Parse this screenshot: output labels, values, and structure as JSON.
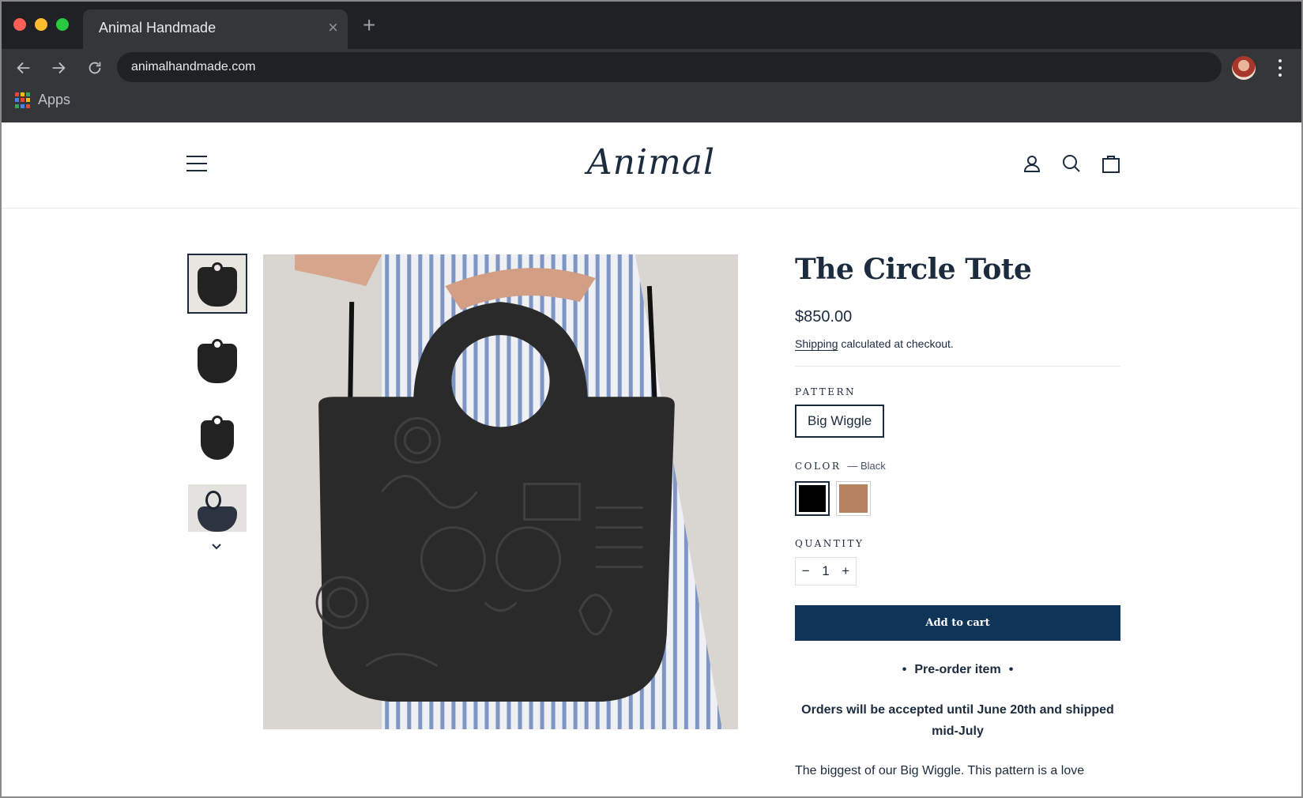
{
  "browser": {
    "tab_title": "Animal Handmade",
    "url": "animalhandmade.com",
    "bookmarks": {
      "apps_label": "Apps"
    }
  },
  "site": {
    "logo_text": "Animal"
  },
  "product": {
    "title": "The Circle Tote",
    "price": "$850.00",
    "shipping_link": "Shipping",
    "shipping_rest": " calculated at checkout.",
    "pattern_label": "PATTERN",
    "pattern_value": "Big Wiggle",
    "color_label": "COLOR",
    "color_selected": "— Black",
    "colors": [
      {
        "name": "Black",
        "hex": "#000000"
      },
      {
        "name": "Tan",
        "hex": "#b5835f"
      }
    ],
    "quantity_label": "QUANTITY",
    "quantity_minus": "−",
    "quantity_value": "1",
    "quantity_plus": "+",
    "add_to_cart": "Add to cart",
    "preorder_bullet": "•",
    "preorder_text": "Pre-order item",
    "orders_note_line1": "Orders will be accepted until June 20th and shipped",
    "orders_note_line2": "mid-July",
    "description_start": "The biggest of our Big Wiggle. This pattern is a love"
  },
  "theme": {
    "navy": "#1c2b3d",
    "button": "#0f3457"
  }
}
